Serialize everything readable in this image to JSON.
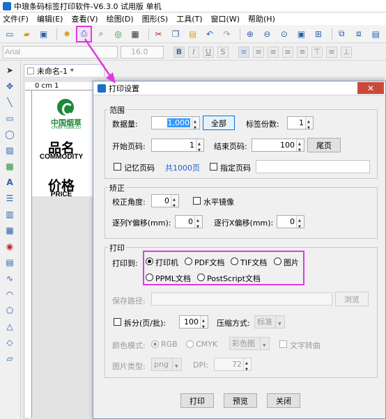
{
  "window": {
    "title": "中琅条码标签打印软件-V6.3.0 试用版 单机"
  },
  "menu": [
    "文件(F)",
    "编辑(E)",
    "查看(V)",
    "绘图(D)",
    "图形(S)",
    "工具(T)",
    "窗口(W)",
    "帮助(H)"
  ],
  "format_bar": {
    "font": "Arial",
    "size": "16.0",
    "bold": "B",
    "italic": "I",
    "underline": "U",
    "strike": "S"
  },
  "document": {
    "tab_title": "未命名-1 *",
    "ruler_label": "0 cm 1"
  },
  "label": {
    "logo_text": "中国烟草",
    "logo_sub": "CHINA TOBACCO",
    "commodity_cn": "品名",
    "commodity_en": "COMMODITY",
    "price_cn": "价格",
    "price_en": "PRICE"
  },
  "dialog": {
    "title": "打印设置",
    "close": "✕",
    "range": {
      "title": "范围",
      "data_qty_label": "数据量:",
      "data_qty_value": "1,000",
      "all_button": "全部",
      "copies_label": "标签份数:",
      "copies_value": "1",
      "start_page_label": "开始页码:",
      "start_page_value": "1",
      "end_page_label": "结束页码:",
      "end_page_value": "100",
      "last_page_button": "尾页",
      "remember_page_label": "记忆页码",
      "total_pages": "共1000页",
      "specify_page_label": "指定页码"
    },
    "correction": {
      "title": "矫正",
      "angle_label": "校正角度:",
      "angle_value": "0",
      "mirror_label": "水平镜像",
      "col_y_label": "逐列Y偏移(mm):",
      "col_y_value": "0",
      "row_x_label": "逐行X偏移(mm):",
      "row_x_value": "0"
    },
    "print": {
      "title": "打印",
      "print_to_label": "打印到:",
      "targets": [
        "打印机",
        "PDF文档",
        "TIF文档",
        "图片",
        "PPML文档",
        "PostScript文档"
      ],
      "selected_target": "打印机",
      "save_path_label": "保存路径:",
      "browse_button": "浏览",
      "split_label": "拆分(页/批):",
      "split_value": "100",
      "compress_label": "压缩方式:",
      "compress_value": "标准",
      "color_mode_label": "颜色模式:",
      "color_rgb": "RGB",
      "color_cmyk": "CMYK",
      "color_select": "彩色图",
      "text_curve_label": "文字转曲",
      "image_type_label": "图片类型:",
      "image_type_value": "png",
      "dpi_label": "DPI:",
      "dpi_value": "72"
    },
    "buttons": {
      "print": "打印",
      "preview": "预览",
      "close": "关闭"
    }
  },
  "colors": {
    "highlight": "#e239e2",
    "accent": "#0078d7",
    "logo_green": "#1a8a3a"
  }
}
